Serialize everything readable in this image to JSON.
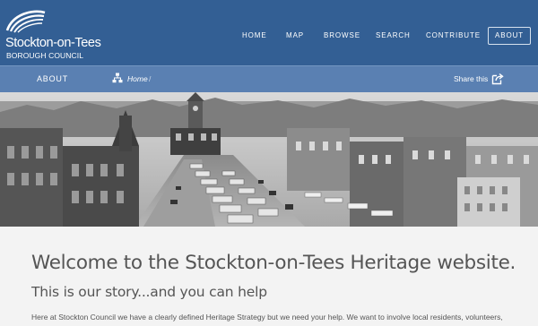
{
  "brand": {
    "name": "Stockton-on-Tees",
    "subtitle": "BOROUGH COUNCIL",
    "logo_icon": "swoosh-icon"
  },
  "nav": {
    "items": [
      {
        "label": "HOME"
      },
      {
        "label": "MAP"
      },
      {
        "label": "BROWSE"
      },
      {
        "label": "SEARCH"
      },
      {
        "label": "CONTRIBUTE"
      },
      {
        "label": "ABOUT"
      }
    ],
    "active": "ABOUT"
  },
  "subnav": {
    "section_title": "ABOUT",
    "breadcrumb": {
      "icon": "sitemap-icon",
      "home": "Home",
      "separator": "/"
    },
    "share": {
      "label": "Share this",
      "icon": "share-icon"
    }
  },
  "banner": {
    "description_icon": "heritage-photo"
  },
  "content": {
    "heading": "Welcome to the Stockton-on-Tees Heritage website.",
    "subheading": "This is our story...and you can help",
    "intro": "Here at Stockton Council we have a clearly defined Heritage Strategy but we need your help.  We want to involve local residents, volunteers,"
  },
  "colors": {
    "header_bg": "#335f94",
    "subbar_bg": "#5a80b2",
    "page_bg": "#f3f3f3",
    "text": "#555555"
  }
}
